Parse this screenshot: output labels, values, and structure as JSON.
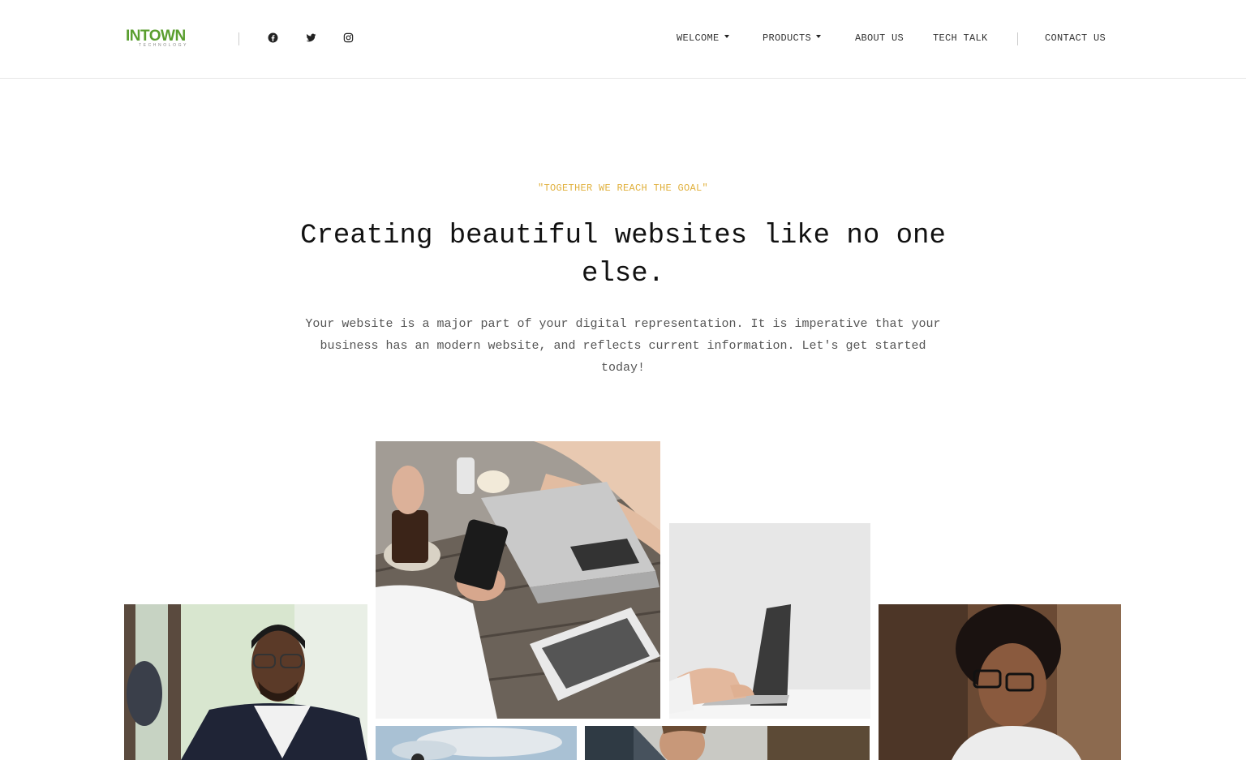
{
  "brand": {
    "logo_text": "INTOWN",
    "logo_subtext": "TECHNOLOGY",
    "colors": {
      "logo_green": "#5a9e2f",
      "accent_gold": "#e0b03c"
    }
  },
  "social": [
    {
      "name": "facebook-icon"
    },
    {
      "name": "twitter-icon"
    },
    {
      "name": "instagram-icon"
    }
  ],
  "nav": {
    "welcome": "WELCOME",
    "products": "PRODUCTS",
    "about": "ABOUT US",
    "tech_talk": "TECH TALK",
    "contact": "CONTACT US"
  },
  "hero": {
    "tagline": "\"TOGETHER WE REACH THE GOAL\"",
    "headline": "Creating beautiful websites like no one else.",
    "lead": "Your website is a major part of your digital representation. It is imperative that your business has an modern website, and reflects current information. Let's get started today!"
  },
  "gallery": [
    {
      "name": "photo-businessman"
    },
    {
      "name": "photo-cafe-laptop-phone"
    },
    {
      "name": "photo-laptop-typing"
    },
    {
      "name": "photo-woman-glasses"
    },
    {
      "name": "photo-sky"
    },
    {
      "name": "photo-man-smiling"
    }
  ]
}
